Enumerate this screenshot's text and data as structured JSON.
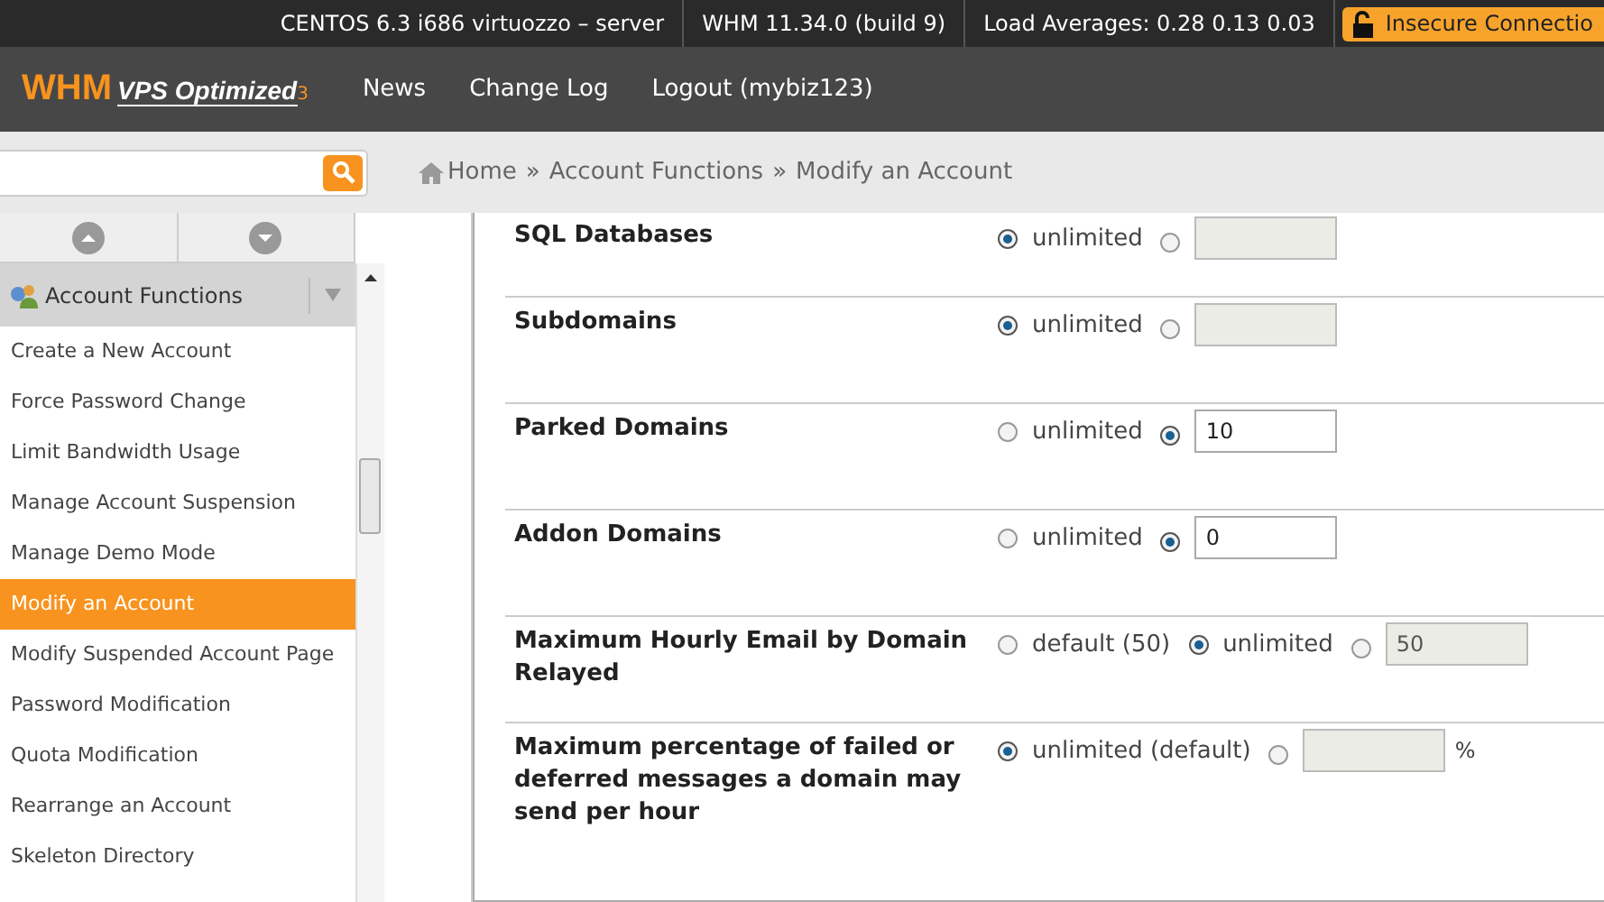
{
  "top_bar": {
    "items": [
      "CENTOS 6.3 i686 virtuozzo – server",
      "WHM 11.34.0 (build 9)",
      "Load Averages: 0.28 0.13 0.03"
    ],
    "security_badge": "Insecure Connectio"
  },
  "nav": {
    "logo": "WHM",
    "logo_tagline": "VPS Optimized",
    "logo_version": "3",
    "links": [
      "News",
      "Change Log",
      "Logout (mybiz123)"
    ]
  },
  "breadcrumb": {
    "items": [
      "Home",
      "Account Functions",
      "Modify an Account"
    ],
    "separators": [
      "»",
      "»"
    ]
  },
  "sidebar": {
    "group": "Account Functions",
    "items": [
      {
        "label": "Create a New Account",
        "selected": false
      },
      {
        "label": "Force Password Change",
        "selected": false
      },
      {
        "label": "Limit Bandwidth Usage",
        "selected": false
      },
      {
        "label": "Manage Account Suspension",
        "selected": false
      },
      {
        "label": "Manage Demo Mode",
        "selected": false
      },
      {
        "label": "Modify an Account",
        "selected": true
      },
      {
        "label": "Modify Suspended Account Page",
        "selected": false
      },
      {
        "label": "Password Modification",
        "selected": false
      },
      {
        "label": "Quota Modification",
        "selected": false
      },
      {
        "label": "Rearrange an Account",
        "selected": false
      },
      {
        "label": "Skeleton Directory",
        "selected": false
      }
    ]
  },
  "form_rows": [
    {
      "label": "SQL Databases",
      "options": [
        {
          "kind": "radio",
          "label": "unlimited",
          "selected": true
        },
        {
          "kind": "input",
          "selected": false,
          "disabled": true
        }
      ]
    },
    {
      "label": "Subdomains",
      "options": [
        {
          "kind": "radio",
          "label": "unlimited",
          "selected": true
        },
        {
          "kind": "input",
          "selected": false,
          "disabled": true
        }
      ]
    },
    {
      "label": "Parked Domains",
      "options": [
        {
          "kind": "radio",
          "label": "unlimited",
          "selected": false
        },
        {
          "kind": "input",
          "selected": true,
          "disabled": false,
          "value": "10"
        }
      ]
    },
    {
      "label": "Addon Domains",
      "options": [
        {
          "kind": "radio",
          "label": "unlimited",
          "selected": false
        },
        {
          "kind": "input",
          "selected": true,
          "disabled": false,
          "value": "0"
        }
      ]
    },
    {
      "label": "Maximum Hourly Email by Domain Relayed",
      "options": [
        {
          "kind": "radio",
          "label": "default (50)",
          "selected": false
        },
        {
          "kind": "radio",
          "label": "unlimited",
          "selected": true
        },
        {
          "kind": "input",
          "selected": false,
          "disabled": true,
          "value": "50"
        }
      ]
    },
    {
      "label": "Maximum percentage of failed or deferred messages a domain may send per hour",
      "options": [
        {
          "kind": "radio",
          "label": "unlimited (default)",
          "selected": true
        },
        {
          "kind": "input",
          "selected": false,
          "disabled": true,
          "suffix": "%"
        }
      ]
    }
  ]
}
